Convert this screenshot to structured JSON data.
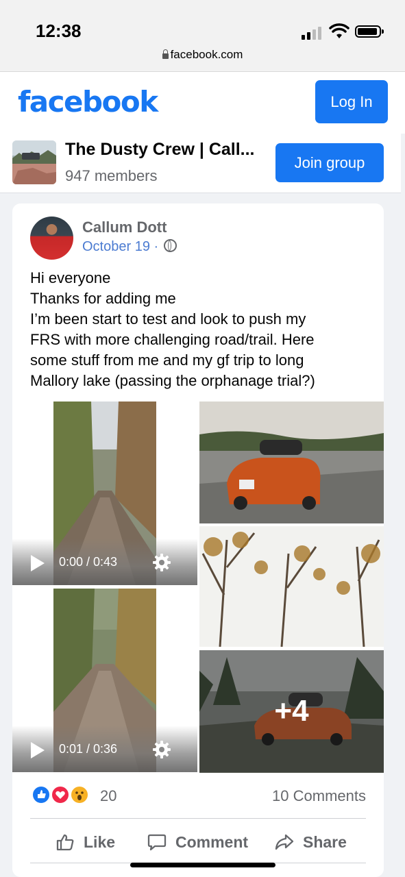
{
  "status_bar": {
    "time": "12:38",
    "url": "facebook.com"
  },
  "header": {
    "logo": "facebook",
    "login_label": "Log In"
  },
  "group": {
    "name": "The Dusty Crew | Call...",
    "members": "947 members",
    "join_label": "Join group"
  },
  "post": {
    "author": "Callum Dott",
    "date": "October 19 ·",
    "body_lines": [
      "Hi everyone",
      "Thanks for adding me",
      "I’m been start to test and look to push my",
      "FRS with more challenging road/trail. Here",
      "some stuff from me and my gf trip to long",
      "Mallory lake (passing the orphanage trial?)"
    ],
    "videos": [
      {
        "time": "0:00 / 0:43"
      },
      {
        "time": "0:01 / 0:36"
      }
    ],
    "more_photos": "+4",
    "reaction_count": "20",
    "comments_count": "10 Comments",
    "actions": {
      "like": "Like",
      "comment": "Comment",
      "share": "Share"
    }
  },
  "icons": [
    "lock-icon",
    "signal-icon",
    "wifi-icon",
    "battery-icon",
    "globe-icon",
    "play-icon",
    "settings-gear-icon",
    "like-reaction-icon",
    "love-reaction-icon",
    "wow-reaction-icon",
    "thumbs-up-icon",
    "comment-bubble-icon",
    "share-arrow-icon"
  ],
  "colors": {
    "brand": "#1877f2",
    "secondary_text": "#65676b",
    "date_link": "#4b7bd1"
  }
}
